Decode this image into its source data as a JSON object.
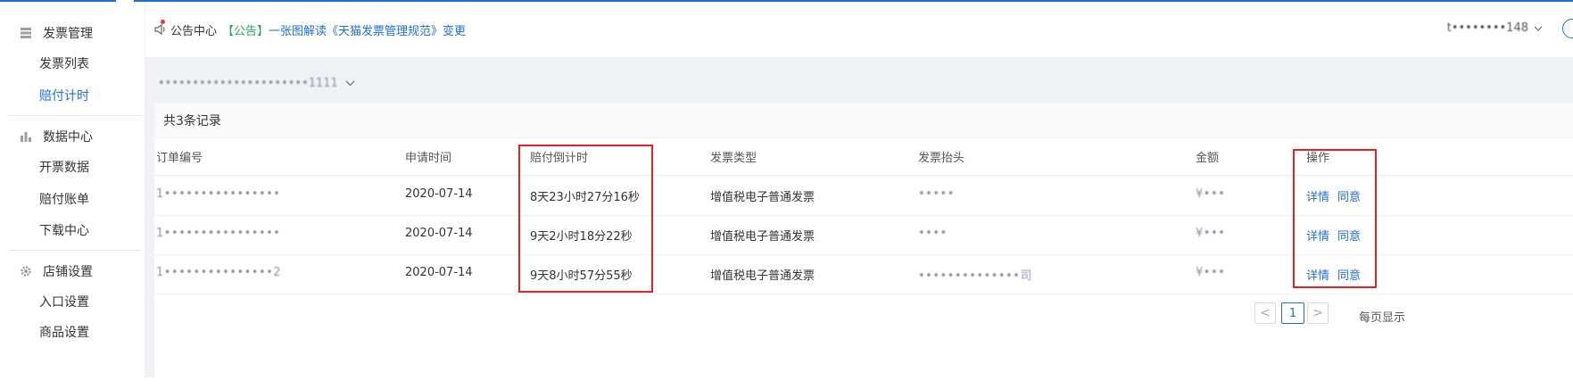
{
  "sidebar": {
    "groups": [
      {
        "title": "发票管理",
        "icon": "invoice-icon",
        "items": [
          {
            "label": "发票列表"
          },
          {
            "label": "赔付计时",
            "active": true
          }
        ]
      },
      {
        "title": "数据中心",
        "icon": "bar-chart-icon",
        "items": [
          {
            "label": "开票数据"
          },
          {
            "label": "赔付账单"
          },
          {
            "label": "下载中心"
          }
        ]
      },
      {
        "title": "店铺设置",
        "icon": "gear-icon",
        "items": [
          {
            "label": "入口设置"
          },
          {
            "label": "商品设置"
          }
        ]
      }
    ]
  },
  "header": {
    "notice_center": "公告中心",
    "notice_tag": "【公告】",
    "notice_link": "一张图解读《天猫发票管理规范》变更",
    "user_name": "t••••••••148"
  },
  "shop_selector": "••••••••••••••••••••••1111",
  "table": {
    "record_count": "共3条记录",
    "columns": [
      "订单编号",
      "申请时间",
      "赔付倒计时",
      "发票类型",
      "发票抬头",
      "金额",
      "操作"
    ],
    "rows": [
      {
        "order_no": "1••••••••••••••••",
        "apply_time": "2020-07-14",
        "countdown": "8天23小时27分16秒",
        "invoice_type": "增值税电子普通发票",
        "invoice_title": "•••••",
        "amount": "¥•••",
        "action_detail": "详情",
        "action_agree": "同意"
      },
      {
        "order_no": "1••••••••••••••••",
        "apply_time": "2020-07-14",
        "countdown": "9天2小时18分22秒",
        "invoice_type": "增值税电子普通发票",
        "invoice_title": "••••",
        "amount": "¥•••",
        "action_detail": "详情",
        "action_agree": "同意"
      },
      {
        "order_no": "1•••••••••••••••2",
        "apply_time": "2020-07-14",
        "countdown": "9天8小时57分55秒",
        "invoice_type": "增值税电子普通发票",
        "invoice_title": "••••••••••••••司",
        "amount": "¥•••",
        "action_detail": "详情",
        "action_agree": "同意"
      }
    ]
  },
  "pagination": {
    "prev": "<",
    "current": "1",
    "next": ">",
    "per_page_label": "每页显示"
  },
  "colors": {
    "accent": "#1f6fd1",
    "highlight_box": "#e3212b",
    "tag_green": "#27a55a"
  }
}
